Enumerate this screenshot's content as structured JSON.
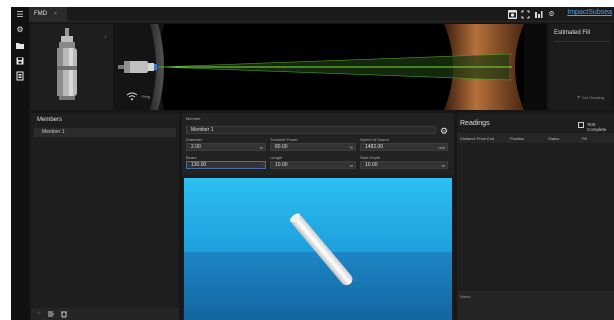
{
  "tab": {
    "label": "FMD",
    "close": "×"
  },
  "brand": "ImpactSubsea",
  "probe": {
    "status_label": "Ping"
  },
  "estimated_fill": {
    "title": "Estimated Fill",
    "action": "Get Reading"
  },
  "members": {
    "title": "Members",
    "items": [
      "Member 1"
    ]
  },
  "member_form": {
    "member_label": "Member",
    "member_value": "Member 1",
    "fields": [
      {
        "label": "Diameter",
        "value": "2.00",
        "unit": "m"
      },
      {
        "label": "Transmit Power",
        "value": "80.00",
        "unit": "%"
      },
      {
        "label": "Speed of Sound",
        "value": "1482.00",
        "unit": "m/s"
      },
      {
        "label": "Beam",
        "value": "130.00",
        "unit": "°"
      },
      {
        "label": "Length",
        "value": "10.00",
        "unit": "m"
      },
      {
        "label": "Start Depth",
        "value": "10.00",
        "unit": "m"
      }
    ]
  },
  "readings": {
    "title": "Readings",
    "test_complete": "Test Complete",
    "columns": [
      "Distance From End",
      "Position",
      "Status",
      "Fill"
    ],
    "notes_label": "Notes"
  },
  "colors": {
    "accent": "#4aa3ff",
    "sky": "#2cc0f2",
    "sea": "#13659f",
    "laser": "#7fdc3c"
  }
}
